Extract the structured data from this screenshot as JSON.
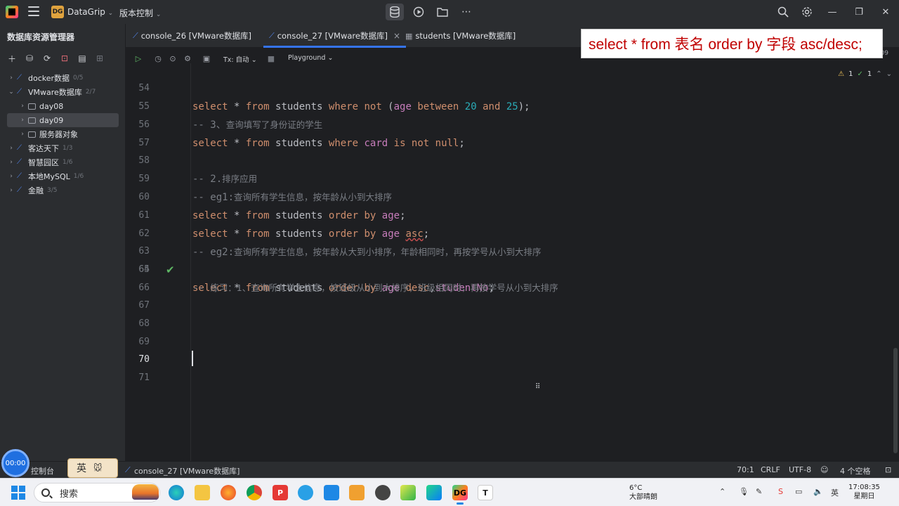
{
  "titlebar": {
    "project_badge": "DG",
    "project_name": "DataGrip",
    "vcs_label": "版本控制"
  },
  "sidebar": {
    "title": "数据库资源管理器",
    "tree": [
      {
        "label": "docker数据",
        "count": "0/5"
      },
      {
        "label": "VMware数据库",
        "count": "2/7"
      },
      {
        "label": "day08"
      },
      {
        "label": "day09"
      },
      {
        "label": "服务器对象"
      },
      {
        "label": "客达天下",
        "count": "1/3"
      },
      {
        "label": "智慧园区",
        "count": "1/6"
      },
      {
        "label": "本地MySQL",
        "count": "1/6"
      },
      {
        "label": "金融",
        "count": "3/5"
      }
    ]
  },
  "tabs": [
    {
      "label": "console_26 [VMware数据库]"
    },
    {
      "label": "console_27 [VMware数据库]"
    },
    {
      "label": "students [VMware数据库]"
    }
  ],
  "hint": "select * from 表名 order by 字段 asc/desc;",
  "editor_toolbar": {
    "tx_label": "Tx: 自动",
    "playground_label": "Playground",
    "schema_label": "day09"
  },
  "editor": {
    "inspection_warn": "1",
    "inspection_ok": "1",
    "line_numbers": [
      "54",
      "55",
      "56",
      "57",
      "58",
      "59",
      "60",
      "61",
      "62",
      "63",
      "64",
      "65",
      "66",
      "67",
      "68",
      "69",
      "70",
      "71"
    ],
    "comments": {
      "l55_prefix": "-- 3、",
      "l55_text": "查询填写了身份证的学生",
      "l58_prefix": "-- 2.",
      "l58_text": "排序应用",
      "l59_prefix": "-- eg1:",
      "l59_text": "查询所有学生信息，按年龄从小到大排序",
      "l62_prefix": "-- eg2:",
      "l62_text": "查询所有学生信息，按年龄从大到小排序，年龄相同时，再按学号从小到大排序",
      "l64_prefix": "-- ",
      "l64_text": "练习：1、查询所有学生信息，按班级从小到大排序，班级相同时，再按学号从小到大排序"
    }
  },
  "statusbar": {
    "timer": "00:00",
    "ime": "英",
    "console_label": "控制台",
    "breadcrumb": "console_27 [VMware数据库]",
    "position": "70:1",
    "line_sep": "CRLF",
    "encoding": "UTF-8",
    "indent": "4 个空格"
  },
  "taskbar": {
    "search_placeholder": "搜索",
    "weather_temp": "6°C",
    "weather_desc": "大部晴朗",
    "time": "17:08:35",
    "weekday": "星期日"
  }
}
